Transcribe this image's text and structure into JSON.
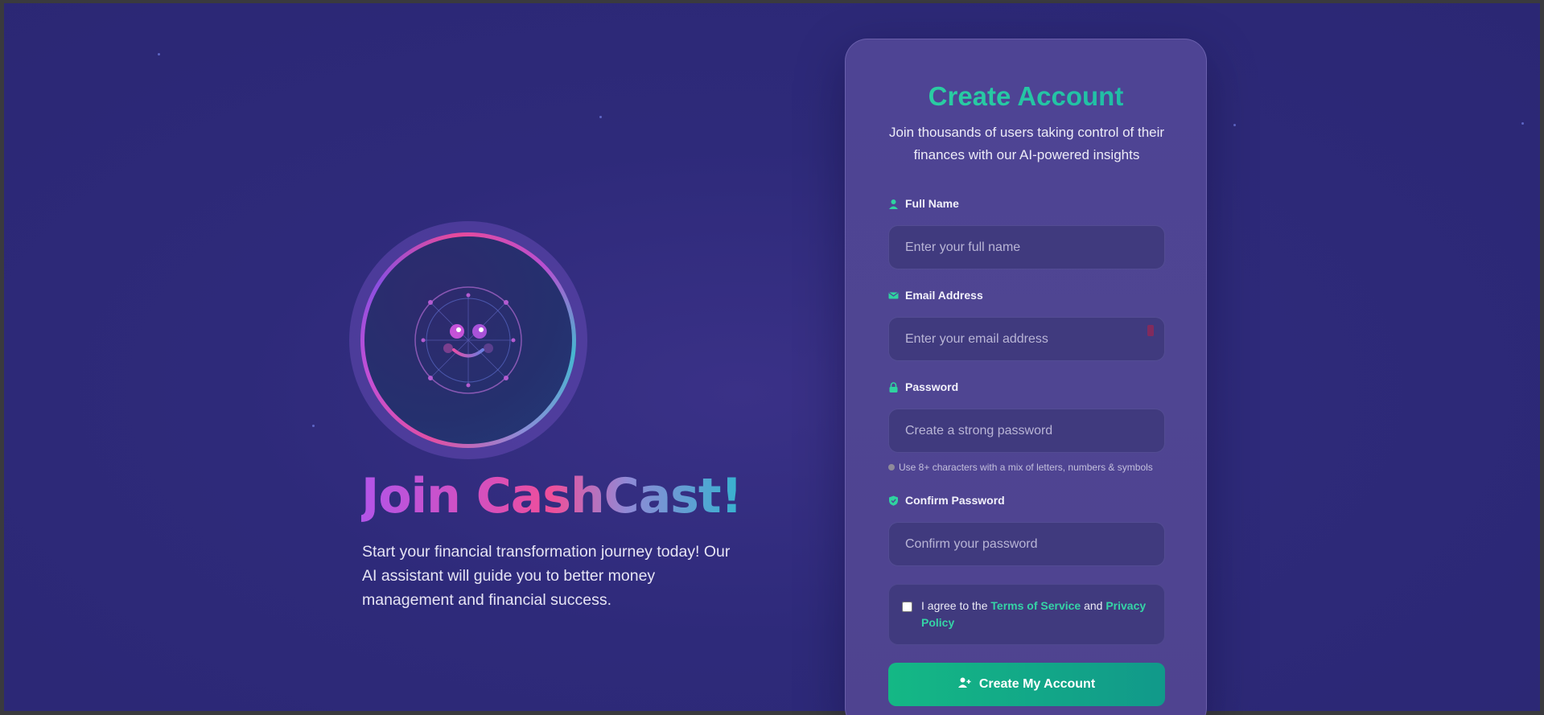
{
  "hero": {
    "title": "Join CashCast!",
    "description": "Start your financial transformation journey today! Our AI assistant will guide you to better money management and financial success."
  },
  "card": {
    "title": "Create Account",
    "subtitle": "Join thousands of users taking control of their finances with our AI-powered insights",
    "fields": [
      {
        "label": "Full Name",
        "placeholder": "Enter your full name",
        "icon": "user-icon"
      },
      {
        "label": "Email Address",
        "placeholder": "Enter your email address",
        "icon": "envelope-icon"
      },
      {
        "label": "Password",
        "placeholder": "Create a strong password",
        "icon": "lock-icon"
      },
      {
        "label": "Confirm Password",
        "placeholder": "Confirm your password",
        "icon": "shield-check-icon"
      }
    ],
    "password_hint": "Use 8+ characters with a mix of letters, numbers & symbols",
    "terms": {
      "prefix": "I agree to the",
      "tos": "Terms of Service",
      "and": "and",
      "privacy": "Privacy Policy"
    },
    "submit_label": "Create My Account"
  },
  "colors": {
    "accent": "#14b885",
    "background": "#2e2a7a",
    "card": "#4e4494"
  }
}
